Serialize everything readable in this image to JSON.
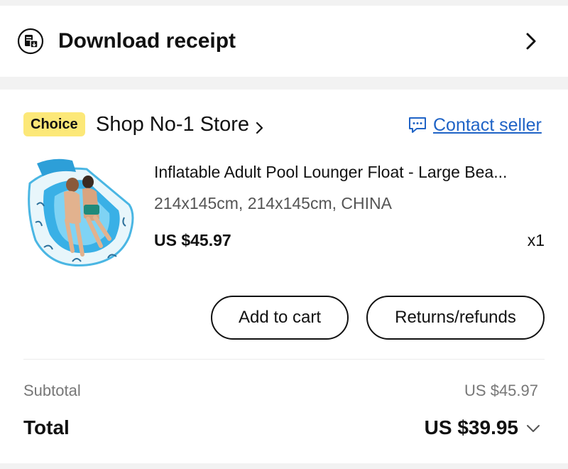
{
  "receipt": {
    "label": "Download receipt",
    "icon": "receipt-download-icon",
    "chevron_icon": "chevron-right-icon"
  },
  "store": {
    "badge": "Choice",
    "badge_color": "#fce878",
    "name": "Shop No-1 Store",
    "chevron_icon": "chevron-right-icon",
    "contact_label": "Contact seller",
    "contact_icon": "chat-bubble-icon",
    "link_color": "#1f63c6"
  },
  "product": {
    "image": "pool-lounger-float-image",
    "title": "Inflatable Adult Pool Lounger Float - Large Bea...",
    "variant": "214x145cm, 214x145cm, CHINA",
    "price": "US $45.97",
    "quantity": "x1"
  },
  "actions": {
    "add_to_cart": "Add to cart",
    "returns": "Returns/refunds"
  },
  "summary": {
    "subtotal_label": "Subtotal",
    "subtotal_value": "US $45.97",
    "total_label": "Total",
    "total_value": "US $39.95",
    "expand_icon": "chevron-down-icon"
  }
}
